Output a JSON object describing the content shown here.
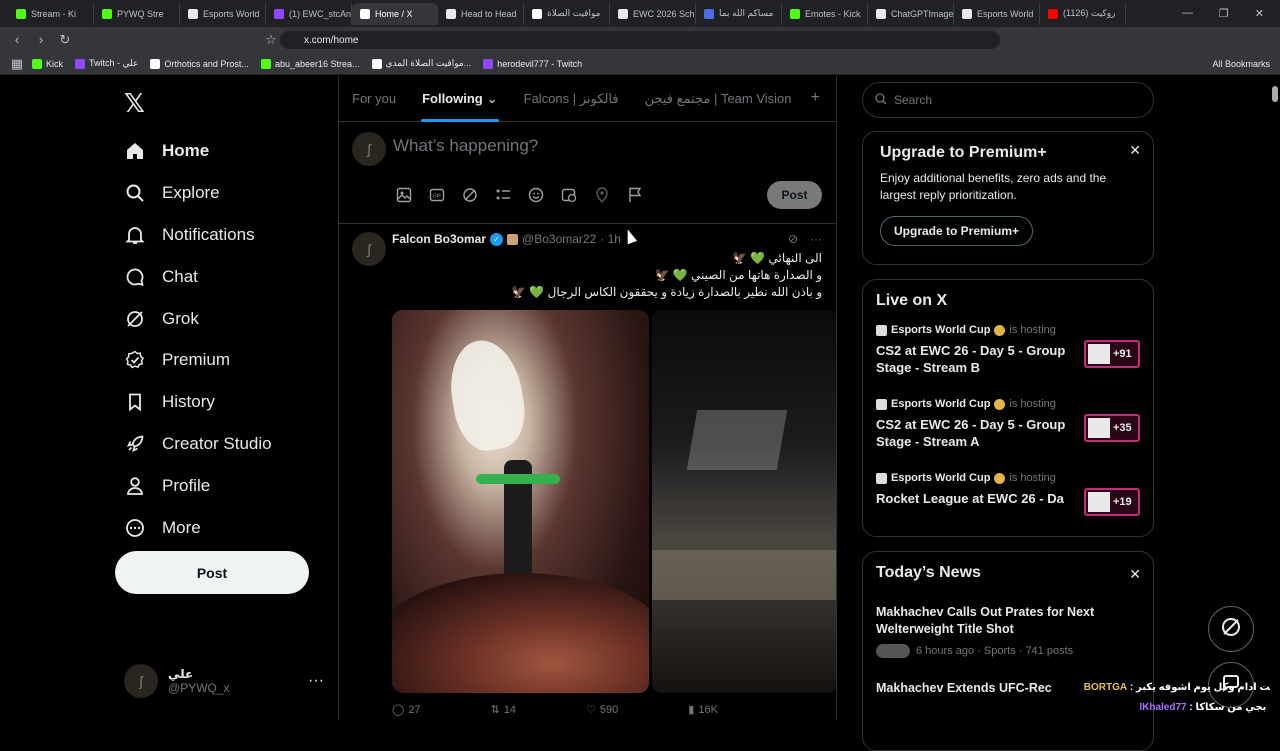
{
  "browser": {
    "tabs": [
      {
        "label": "Stream - Ki",
        "color": "#53fc18",
        "active": false
      },
      {
        "label": "PYWQ Stre",
        "color": "#53fc18",
        "active": false
      },
      {
        "label": "Esports World",
        "color": "#e8eaed",
        "active": false
      },
      {
        "label": "(1) EWC_stcAn",
        "color": "#9146ff",
        "active": false
      },
      {
        "label": "Home / X",
        "color": "#ffffff",
        "active": true
      },
      {
        "label": "Head to Head",
        "color": "#e8eaed",
        "active": false
      },
      {
        "label": "مواقيت الصلاة",
        "color": "#ffffff",
        "active": false
      },
      {
        "label": "EWC 2026 Sch",
        "color": "#e8eaed",
        "active": false
      },
      {
        "label": "مساكم الله بما",
        "color": "#4b6fe0",
        "active": false
      },
      {
        "label": "Emotes - Kick",
        "color": "#53fc18",
        "active": false
      },
      {
        "label": "ChatGPTImage",
        "color": "#e8eaed",
        "active": false
      },
      {
        "label": "Esports World",
        "color": "#e8eaed",
        "active": false
      },
      {
        "label": "(1126) روكيت",
        "color": "#ff0000",
        "active": false
      }
    ],
    "url": "x.com/home",
    "bookmarks": [
      {
        "label": "Kick",
        "color": "#53fc18"
      },
      {
        "label": "Twitch - علي",
        "color": "#9146ff"
      },
      {
        "label": "Orthotics and Prost...",
        "color": "#ffffff"
      },
      {
        "label": "abu_abeer16 Strea...",
        "color": "#53fc18"
      },
      {
        "label": "مواقيت الصلاة المدي...",
        "color": "#ffffff"
      },
      {
        "label": "herodevil777 - Twitch",
        "color": "#9146ff"
      }
    ],
    "all_bookmarks": "All Bookmarks"
  },
  "sidebar": {
    "items": [
      {
        "label": "Home",
        "icon": "home-icon"
      },
      {
        "label": "Explore",
        "icon": "search-icon"
      },
      {
        "label": "Notifications",
        "icon": "bell-icon"
      },
      {
        "label": "Chat",
        "icon": "chat-icon"
      },
      {
        "label": "Grok",
        "icon": "grok-icon"
      },
      {
        "label": "Premium",
        "icon": "premium-icon"
      },
      {
        "label": "History",
        "icon": "bookmark-icon"
      },
      {
        "label": "Creator Studio",
        "icon": "rocket-icon"
      },
      {
        "label": "Profile",
        "icon": "person-icon"
      },
      {
        "label": "More",
        "icon": "more-circle-icon"
      }
    ],
    "post_label": "Post",
    "account": {
      "name": "علي",
      "handle": "@PYWQ_x"
    }
  },
  "feed": {
    "tabs": [
      "For you",
      "Following",
      "Falcons | فالكونز",
      "مجتمع فيجن | Team Vision"
    ],
    "selected_tab": "Following",
    "composer_placeholder": "What’s happening?",
    "composer_post": "Post",
    "tweet": {
      "name": "Falcon Bo3omar",
      "handle": "@Bo3omar22",
      "time": "· 1h",
      "lines": [
        "الى النهائي 💚 🦅",
        "و الصدارة هاتها من الصيني 💚 🦅",
        "و باذن الله نطير بالصدارة زيادة و يحققون الكاس الرجال 💚 🦅"
      ],
      "stats": {
        "replies": "27",
        "reposts": "14",
        "likes": "590",
        "views": "16K"
      }
    }
  },
  "right": {
    "search_placeholder": "Search",
    "premium": {
      "title": "Upgrade to Premium+",
      "desc": "Enjoy additional benefits, zero ads and the largest reply prioritization.",
      "button": "Upgrade to Premium+"
    },
    "live": {
      "title": "Live on X",
      "items": [
        {
          "host": "Esports World Cup",
          "hosting": "is hosting",
          "title": "CS2 at EWC 26 - Day 5 - Group Stage - Stream B",
          "count": "+91"
        },
        {
          "host": "Esports World Cup",
          "hosting": "is hosting",
          "title": "CS2 at EWC 26 - Day 5 - Group Stage - Stream A",
          "count": "+35"
        },
        {
          "host": "Esports World Cup",
          "hosting": "is hosting",
          "title": "Rocket League at EWC 26 - Da",
          "count": "+19"
        }
      ]
    },
    "news": {
      "title": "Today’s News",
      "items": [
        {
          "headline": "Makhachev Calls Out Prates for Next Welterweight Title Shot",
          "meta": "6 hours ago · Sports · 741 posts"
        },
        {
          "headline": "Makhachev Extends UFC-Rec",
          "meta": ""
        }
      ]
    }
  },
  "overlay": {
    "line1_user": "BORTGA",
    "line1_text": "كنت ادام وكل يوم اشوفه يكبر :",
    "line2_user": "lKhaled77",
    "line2_text": "انا بجي من سكاكا :"
  }
}
